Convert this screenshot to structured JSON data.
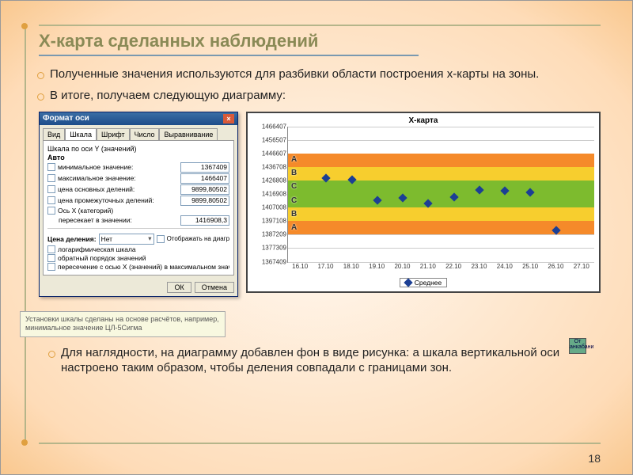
{
  "title": "X-карта сделанных наблюдений",
  "bullets_top": [
    "Полученные значения используются для разбивки области построения x-карты на зоны.",
    "В итоге, получаем следующую диаграмму:"
  ],
  "bullets_bottom": [
    "Для наглядности, на диаграмму добавлен фон в виде рисунка: а шкала вертикальной оси настроено таким образом, чтобы деления совпадали с границами зон."
  ],
  "note": "Установки шкалы сделаны на основе расчётов, например, минимальное значение ЦЛ-5Сигма",
  "page_number": "18",
  "image_caption": "От анкабани",
  "dialog": {
    "title": "Формат оси",
    "tabs": [
      "Вид",
      "Шкала",
      "Шрифт",
      "Число",
      "Выравнивание"
    ],
    "active_tab": "Шкала",
    "section1": "Шкала по оси Y (значений)",
    "auto_label": "Авто",
    "rows": [
      {
        "label": "минимальное значение:",
        "value": "1367409"
      },
      {
        "label": "максимальное значение:",
        "value": "1466407"
      },
      {
        "label": "цена основных делений:",
        "value": "9899,80502"
      },
      {
        "label": "цена промежуточных делений:",
        "value": "9899,80502"
      }
    ],
    "axisx_label": "Ось X (категорий)",
    "cross_label": "пересекает в значении:",
    "cross_value": "1416908,3",
    "price_label": "Цена деления:",
    "price_value": "Нет",
    "show_on": "Отображать на диаграмме",
    "check_rows": [
      "логарифмическая шкала",
      "обратный порядок значений",
      "пересечение с осью X (значений) в максимальном значении"
    ],
    "ok": "ОК",
    "cancel": "Отмена"
  },
  "chart_data": {
    "type": "scatter",
    "title": "X-карта",
    "ylabel": "",
    "xlabel": "",
    "ylim": [
      1367409,
      1466407
    ],
    "y_ticks": [
      1466407,
      1456507,
      1446607,
      1436708,
      1426808,
      1416908,
      1407008,
      1397108,
      1387209,
      1377309,
      1367409
    ],
    "x_categories": [
      "16.10",
      "17.10",
      "18.10",
      "19.10",
      "20.10",
      "21.10",
      "22.10",
      "23.10",
      "24.10",
      "25.10",
      "26.10",
      "27.10"
    ],
    "zones": [
      {
        "label": "A",
        "from": 1436708,
        "to": 1446607,
        "color": "#f58a2a"
      },
      {
        "label": "B",
        "from": 1426808,
        "to": 1436708,
        "color": "#f7ce2e"
      },
      {
        "label": "C",
        "from": 1416908,
        "to": 1426808,
        "color": "#7dbb2e"
      },
      {
        "label": "C",
        "from": 1407008,
        "to": 1416908,
        "color": "#7dbb2e"
      },
      {
        "label": "B",
        "from": 1397108,
        "to": 1407008,
        "color": "#f7ce2e"
      },
      {
        "label": "A",
        "from": 1387209,
        "to": 1397108,
        "color": "#f58a2a"
      }
    ],
    "series": [
      {
        "name": "Среднее",
        "values": [
          {
            "x": "17.10",
            "y": 1428500
          },
          {
            "x": "18.10",
            "y": 1427200
          },
          {
            "x": "19.10",
            "y": 1412500
          },
          {
            "x": "20.10",
            "y": 1414000
          },
          {
            "x": "21.10",
            "y": 1410000
          },
          {
            "x": "22.10",
            "y": 1414500
          },
          {
            "x": "23.10",
            "y": 1420000
          },
          {
            "x": "24.10",
            "y": 1419000
          },
          {
            "x": "25.10",
            "y": 1418000
          },
          {
            "x": "26.10",
            "y": 1390000
          }
        ]
      }
    ],
    "legend": "Среднее"
  }
}
